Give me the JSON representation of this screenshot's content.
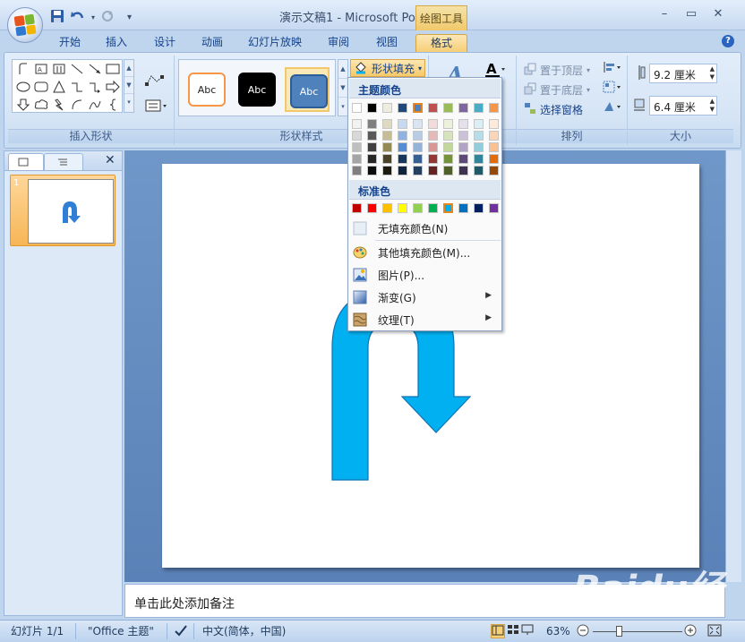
{
  "window": {
    "title": "演示文稿1 - Microsoft PowerPoint",
    "context_tool": "绘图工具",
    "buttons": {
      "minimize": "–",
      "maximize": "▭",
      "close": "✕"
    }
  },
  "quick_access": {
    "save": "save-icon",
    "undo": "undo-icon",
    "redo": "redo-icon",
    "customize": "▾"
  },
  "tabs": [
    {
      "label": "开始"
    },
    {
      "label": "插入"
    },
    {
      "label": "设计"
    },
    {
      "label": "动画"
    },
    {
      "label": "幻灯片放映"
    },
    {
      "label": "审阅"
    },
    {
      "label": "视图"
    },
    {
      "label": "格式",
      "active": true
    }
  ],
  "ribbon": {
    "insert_shapes_label": "插入形状",
    "shape_styles_label": "形状样式",
    "arrange_label": "排列",
    "size_label": "大小",
    "style_sample": "Abc",
    "shape_fill_label": "形状填充",
    "bring_front": "置于顶层",
    "send_back": "置于底层",
    "selection_pane": "选择窗格",
    "height_value": "9.2 厘米",
    "width_value": "6.4 厘米"
  },
  "fill_menu": {
    "theme_colors_header": "主题颜色",
    "standard_colors_header": "标准色",
    "theme_top_row": [
      "#ffffff",
      "#000000",
      "#eeece1",
      "#1f497d",
      "#4f81bd",
      "#c0504d",
      "#9bbb59",
      "#8064a2",
      "#4bacc6",
      "#f79646"
    ],
    "theme_shades": [
      [
        "#f2f2f2",
        "#7f7f7f",
        "#ddd9c3",
        "#c6d9f0",
        "#dbe5f1",
        "#f2dcdb",
        "#ebf1dd",
        "#e5e0ec",
        "#dbeef3",
        "#fdeada"
      ],
      [
        "#d8d8d8",
        "#595959",
        "#c4bd97",
        "#8db3e2",
        "#b8cce4",
        "#e5b9b7",
        "#d7e3bc",
        "#ccc1d9",
        "#b7dde8",
        "#fbd5b5"
      ],
      [
        "#bfbfbf",
        "#3f3f3f",
        "#938953",
        "#548dd4",
        "#95b3d7",
        "#d99694",
        "#c3d69b",
        "#b2a2c7",
        "#92cddc",
        "#fac08f"
      ],
      [
        "#a5a5a5",
        "#262626",
        "#494429",
        "#17365d",
        "#366092",
        "#953734",
        "#76923c",
        "#5f497a",
        "#31859b",
        "#e36c09"
      ],
      [
        "#7f7f7f",
        "#0c0c0c",
        "#1d1b10",
        "#0f243e",
        "#244061",
        "#632423",
        "#4f6128",
        "#3f3151",
        "#205867",
        "#974806"
      ]
    ],
    "standard_colors": [
      "#c00000",
      "#ff0000",
      "#ffc000",
      "#ffff00",
      "#92d050",
      "#00b050",
      "#00b0f0",
      "#0070c0",
      "#002060",
      "#7030a0"
    ],
    "items": {
      "no_fill": "无填充颜色(N)",
      "more_colors": "其他填充颜色(M)...",
      "picture": "图片(P)...",
      "gradient": "渐变(G)",
      "texture": "纹理(T)"
    }
  },
  "slides_pane": {
    "slide_number": "1"
  },
  "notes": {
    "placeholder": "单击此处添加备注"
  },
  "status": {
    "slide": "幻灯片 1/1",
    "theme": "\"Office 主题\"",
    "language": "中文(简体，中国)",
    "zoom": "63%"
  },
  "shape_color": "#00b0f0",
  "watermark": "Baidu经验"
}
